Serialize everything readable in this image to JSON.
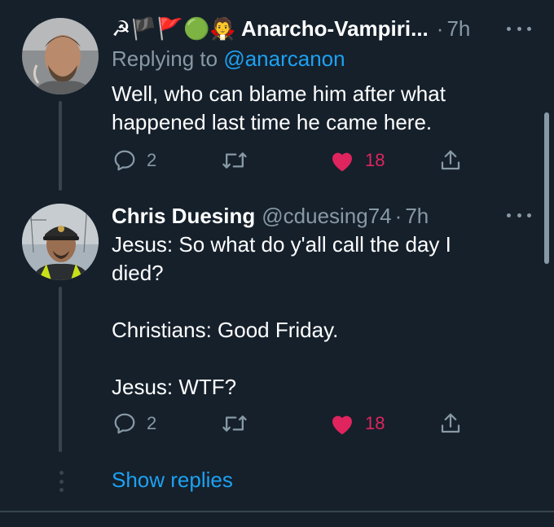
{
  "tweets": [
    {
      "display_name": "☭🏴🚩🟢🧛 Anarcho-Vampiri...",
      "time": "7h",
      "replying_prefix": "Replying to ",
      "replying_to": "@anarcanon",
      "text": "Well, who can blame him after what\nhappened last time he came here.",
      "replies": "2",
      "likes": "18",
      "avatar_icon": "user-photo-icon"
    },
    {
      "display_name": "Chris Duesing",
      "handle": "@cduesing74",
      "time": "7h",
      "text": "Jesus: So what do y'all call the day I\ndied?\n\nChristians: Good Friday.\n\nJesus: WTF?",
      "replies": "2",
      "likes": "18",
      "avatar_icon": "user-photo-icon"
    }
  ],
  "separator": "·",
  "show_replies": "Show replies",
  "colors": {
    "background": "#15202b",
    "text": "#ffffff",
    "muted": "#8899a6",
    "accent": "#1da1f2",
    "like": "#e0245e",
    "divider": "#38444d"
  }
}
